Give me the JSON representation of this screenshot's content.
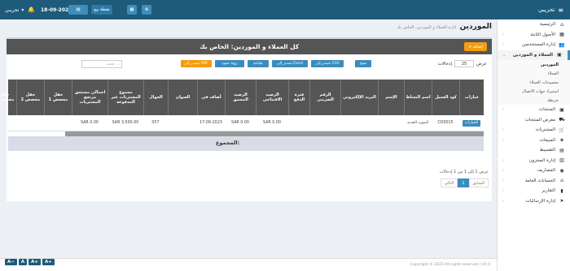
{
  "topbar": {
    "brand": "تجريبي",
    "user": "تجريبي",
    "date": "18-09-2023",
    "pos_label": "نقطة بيع",
    "pos2_label": ""
  },
  "sidebar": {
    "items": [
      {
        "label": "الرئيسية",
        "icon": "home-icon",
        "glyph": "⌂"
      },
      {
        "label": "الأصول الثابتة",
        "icon": "building-icon",
        "glyph": "▦"
      },
      {
        "label": "إدارة المستخدمين",
        "icon": "users-icon",
        "glyph": "👥"
      },
      {
        "label": "العملاء و الموردين",
        "icon": "address-book-icon",
        "glyph": "▣"
      }
    ],
    "subitems": [
      {
        "label": "الموردين"
      },
      {
        "label": "العملاء"
      },
      {
        "label": "مجموعات العملاء"
      },
      {
        "label": "استيراد جهات الاتصال"
      },
      {
        "label": "خريطة"
      }
    ],
    "items2": [
      {
        "label": "المنتجات",
        "icon": "cube-icon",
        "glyph": "▣"
      },
      {
        "label": "معرض المنتجات",
        "icon": "truck-icon",
        "glyph": "⛟"
      },
      {
        "label": "المشتريات",
        "icon": "cart-icon",
        "glyph": "🛒"
      },
      {
        "label": "المبيعات",
        "icon": "tag-icon",
        "glyph": "◈"
      },
      {
        "label": "التقسيط",
        "icon": "money-icon",
        "glyph": "▤"
      },
      {
        "label": "إدارة المخزون",
        "icon": "boxes-icon",
        "glyph": "▥"
      },
      {
        "label": "المصاريف",
        "icon": "wallet-icon",
        "glyph": "◉"
      },
      {
        "label": "الحسابات العامة",
        "icon": "bank-icon",
        "glyph": "⌂"
      },
      {
        "label": "التقارير",
        "icon": "chart-icon",
        "glyph": "▮"
      },
      {
        "label": "إدارة الإرساليات",
        "icon": "send-icon",
        "glyph": "➤"
      }
    ]
  },
  "page": {
    "title": "الموردين",
    "breadcrumb": "ادارة العملاء و الموردين، الخاص بك"
  },
  "box": {
    "title": "كل العملاء و الموردين: الخاص بك",
    "add_label": "إضافة"
  },
  "controls": {
    "show_label": "عرض",
    "entries_value": "25",
    "entries_label": "إدخالات",
    "search_placeholder": "بحث ...",
    "exports": [
      {
        "label": "تصدير إلى CSV",
        "color": "#3c8dbc"
      },
      {
        "label": "تصدير إلى Excel",
        "color": "#3c8dbc"
      },
      {
        "label": "طباعة",
        "color": "#3c8dbc"
      },
      {
        "label": "رؤية عمود",
        "color": "#3c8dbc"
      },
      {
        "label": "تصدير إلى PDF",
        "color": "#f39c12"
      },
      {
        "label": "نسخ",
        "color": "#3c8dbc"
      }
    ]
  },
  "table": {
    "headers": [
      "خيارات",
      "كود العميل",
      "اسم النشاط",
      "الإسم",
      "البريد الإلكتروني",
      "الرقم الضريبي",
      "فترة الدفع",
      "الرصيد الافتتاحي",
      "الرصيد المسبق",
      "أضاف في",
      "العنوان",
      "الجوال",
      "مجموع المشتريات غير المدفوعة",
      "اجمالي مستحق مرتجع المشتريات",
      "حقل مخصص 1",
      "حقل مخصص 2",
      "حقل مخصص 3"
    ],
    "row": [
      "الخيارات",
      "CO0015",
      "المورد الجديد",
      "",
      "",
      "",
      "",
      "SAR 0.00",
      "SAR 0.00",
      "17-09-2023",
      "",
      "057",
      "SAR 3,500.00",
      "SAR 0.00",
      "",
      "",
      ""
    ],
    "total_label": "المجموع:"
  },
  "pagination": {
    "info": "عرض 1 إلى 1 من 1 إدخالات",
    "prev": "السابق",
    "current": "1",
    "next": "التالي"
  },
  "footer": {
    "text": "Copyright © 2023 All rights reserved | V4.0"
  },
  "zoom": [
    "A−",
    "A",
    "A+",
    "A+"
  ]
}
